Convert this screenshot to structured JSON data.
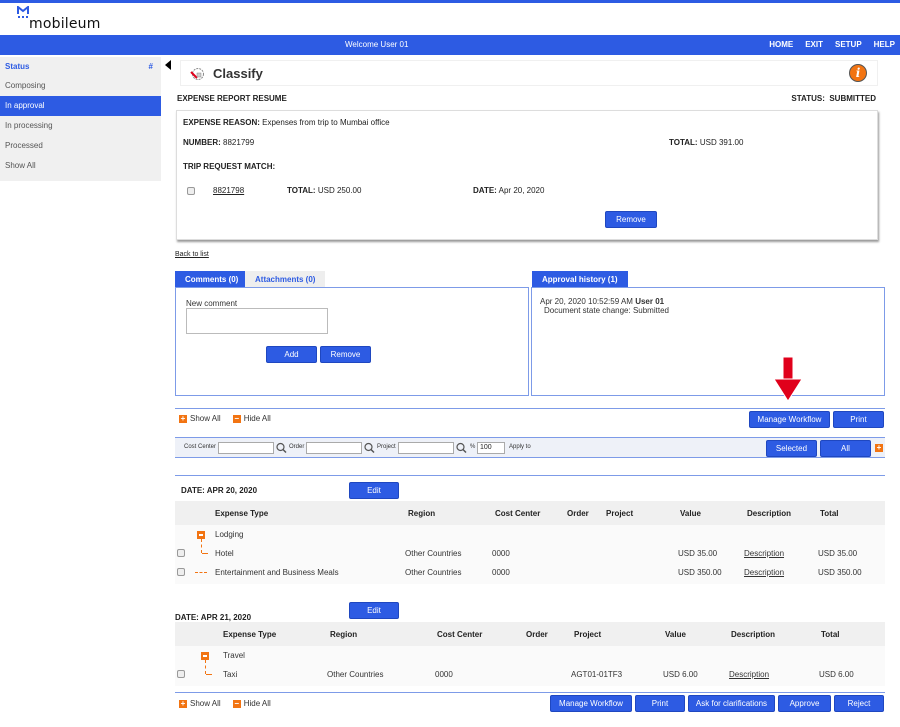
{
  "app": {
    "brand": "mobileum",
    "welcome": "Welcome User 01"
  },
  "nav": {
    "links": [
      "HOME",
      "EXIT",
      "SETUP",
      "HELP"
    ]
  },
  "sidebar": {
    "header": "Status",
    "header_icon": "#",
    "items": [
      {
        "label": "Composing",
        "active": false
      },
      {
        "label": "In approval",
        "active": true
      },
      {
        "label": "In processing",
        "active": false
      },
      {
        "label": "Processed",
        "active": false
      },
      {
        "label": "Show All",
        "active": false
      }
    ]
  },
  "page": {
    "title": "Classify",
    "section_title": "EXPENSE REPORT RESUME",
    "status_label": "STATUS:",
    "status_value": "SUBMITTED"
  },
  "resume": {
    "reason_label": "EXPENSE REASON:",
    "reason_value": "Expenses from trip to Mumbai office",
    "number_label": "NUMBER:",
    "number_value": "8821799",
    "total_label": "TOTAL:",
    "total_value": "USD 391.00",
    "trip_match_label": "TRIP REQUEST MATCH:",
    "trip": {
      "number": "8821798",
      "total_label": "TOTAL:",
      "total_value": "USD 250.00",
      "date_label": "DATE:",
      "date_value": "Apr 20, 2020"
    },
    "remove_label": "Remove"
  },
  "back_to_list": "Back to list",
  "comments": {
    "tabs": [
      "Comments (0)",
      "Attachments (0)"
    ],
    "new_comment_label": "New comment",
    "new_comment_value": "",
    "add_label": "Add",
    "remove_label": "Remove"
  },
  "approval": {
    "tab": "Approval history (1)",
    "entry_time": "Apr 20, 2020 10:52:59 AM",
    "entry_user": "User 01",
    "entry_text": "Document state change: Submitted"
  },
  "toolbar": {
    "show_all": "Show All",
    "hide_all": "Hide All",
    "manage_workflow": "Manage Workflow",
    "print": "Print"
  },
  "filter": {
    "cost_center_label": "Cost Center",
    "cost_center_value": "",
    "order_label": "Order",
    "order_value": "",
    "project_label": "Project",
    "project_value": "",
    "percent_label": "%",
    "percent_value": "100",
    "apply_to_label": "Apply to",
    "selected_label": "Selected",
    "all_label": "All"
  },
  "groups": [
    {
      "date": "DATE: APR 20, 2020",
      "edit_label": "Edit",
      "headers": [
        "Expense Type",
        "Region",
        "Cost Center",
        "Order",
        "Project",
        "Value",
        "Description",
        "Total"
      ],
      "category": "Lodging",
      "rows": [
        {
          "type": "Hotel",
          "region": "Other Countries",
          "cost_center": "0000",
          "order": "",
          "project": "",
          "value": "USD 35.00",
          "description": "Description",
          "total": "USD 35.00"
        },
        {
          "type": "Entertainment and Business Meals",
          "region": "Other Countries",
          "cost_center": "0000",
          "order": "",
          "project": "",
          "value": "USD 350.00",
          "description": "Description",
          "total": "USD 350.00"
        }
      ]
    },
    {
      "date": "DATE: APR 21, 2020",
      "edit_label": "Edit",
      "headers": [
        "Expense Type",
        "Region",
        "Cost Center",
        "Order",
        "Project",
        "Value",
        "Description",
        "Total"
      ],
      "category": "Travel",
      "rows": [
        {
          "type": "Taxi",
          "region": "Other Countries",
          "cost_center": "0000",
          "order": "",
          "project": "AGT01-01TF3",
          "value": "USD 6.00",
          "description": "Description",
          "total": "USD 6.00"
        }
      ]
    }
  ],
  "footer": {
    "show_all": "Show All",
    "hide_all": "Hide All",
    "buttons": [
      "Manage Workflow",
      "Print",
      "Ask for clarifications",
      "Approve",
      "Reject"
    ]
  },
  "colors": {
    "primary": "#2d5be3",
    "accent": "#f27412",
    "arrow": "#e0001b"
  }
}
